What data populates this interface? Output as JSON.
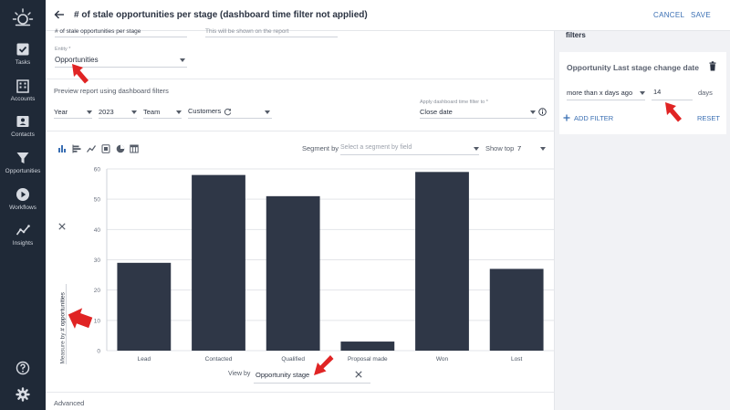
{
  "nav": {
    "items": [
      {
        "label": "Tasks"
      },
      {
        "label": "Accounts"
      },
      {
        "label": "Contacts"
      },
      {
        "label": "Opportunities"
      },
      {
        "label": "Workflows"
      },
      {
        "label": "Insights"
      }
    ]
  },
  "header": {
    "title": "# of stale opportunities per stage (dashboard time filter not applied)",
    "cancel": "CANCEL",
    "save": "SAVE"
  },
  "form": {
    "name_value": "# of stale opportunities per stage",
    "description_placeholder": "This will be shown on the report",
    "entity_label": "Entity *",
    "entity_value": "Opportunities",
    "preview_label": "Preview report using dashboard filters",
    "period": "Year",
    "year": "2023",
    "team": "Team",
    "customers": "Customers",
    "time_filter_label": "Apply dashboard time filter to *",
    "time_filter_value": "Close date",
    "segment_label": "Segment by",
    "segment_placeholder": "Select a segment by field",
    "show_top_label": "Show top",
    "show_top_value": "7",
    "measure_label": "Measure by",
    "measure_value": "# opportunities",
    "view_by_label": "View by",
    "view_by_value": "Opportunity stage",
    "advanced": "Advanced"
  },
  "filters": {
    "title": "filters",
    "filter_name": "Opportunity Last stage change date",
    "operator": "more than x days ago",
    "value": "14",
    "unit": "days",
    "add_filter": "ADD FILTER",
    "reset": "RESET"
  },
  "colors": {
    "sidebar": "#1f2937",
    "bar": "#2f3747",
    "accent": "#3a6fb3",
    "annotation": "#e02424"
  },
  "chart_data": {
    "type": "bar",
    "categories": [
      "Lead",
      "Contacted",
      "Qualified",
      "Proposal made",
      "Won",
      "Lost"
    ],
    "values": [
      29,
      58,
      51,
      3,
      59,
      27
    ],
    "ylim": [
      0,
      60
    ],
    "yticks": [
      0,
      10,
      20,
      30,
      40,
      50,
      60
    ],
    "grid": true
  }
}
